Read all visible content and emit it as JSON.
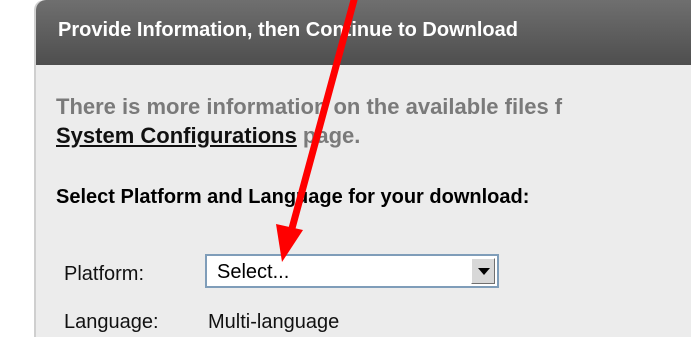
{
  "panel": {
    "title": "Provide Information, then Continue to Download"
  },
  "intro": {
    "line1": "There is more information on the available files f",
    "link_text": "System Configurations",
    "line2_suffix": " page."
  },
  "selection": {
    "heading": "Select Platform and Language for your download:",
    "platform": {
      "label": "Platform:",
      "selected": "Select..."
    },
    "language": {
      "label": "Language:",
      "value": "Multi-language"
    }
  },
  "annotation": {
    "arrow_color": "#ff0000"
  }
}
